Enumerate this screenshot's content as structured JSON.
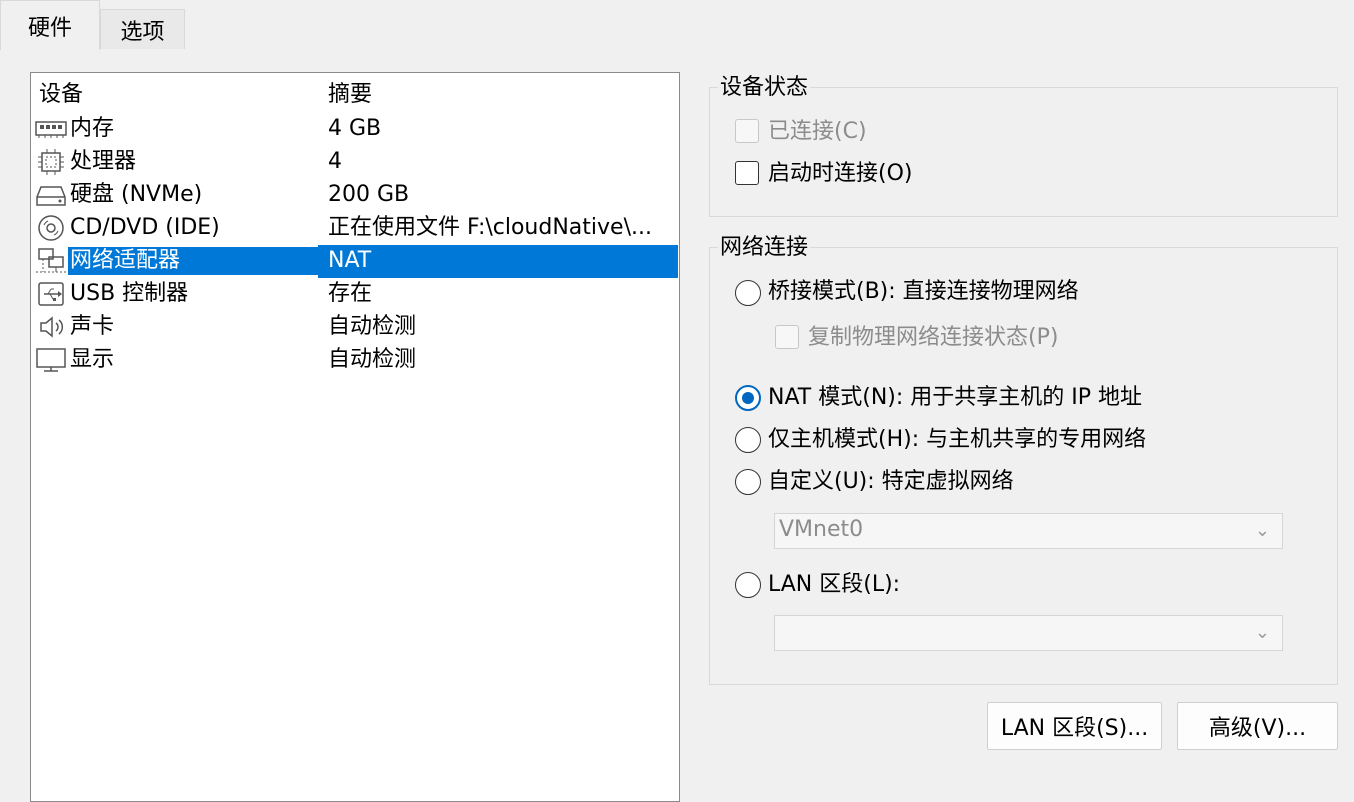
{
  "tabs": {
    "hardware": "硬件",
    "options": "选项"
  },
  "device_list": {
    "header_device": "设备",
    "header_summary": "摘要",
    "rows": [
      {
        "name": "内存",
        "summary": "4 GB",
        "icon": "memory-icon"
      },
      {
        "name": "处理器",
        "summary": "4",
        "icon": "processor-icon"
      },
      {
        "name": "硬盘 (NVMe)",
        "summary": "200 GB",
        "icon": "harddisk-icon"
      },
      {
        "name": "CD/DVD (IDE)",
        "summary": "正在使用文件 F:\\cloudNative\\...",
        "icon": "cd-dvd-icon"
      },
      {
        "name": "网络适配器",
        "summary": "NAT",
        "icon": "network-adapter-icon",
        "selected": true
      },
      {
        "name": "USB 控制器",
        "summary": "存在",
        "icon": "usb-icon"
      },
      {
        "name": "声卡",
        "summary": "自动检测",
        "icon": "speaker-icon"
      },
      {
        "name": "显示",
        "summary": "自动检测",
        "icon": "monitor-icon"
      }
    ]
  },
  "device_status": {
    "title": "设备状态",
    "connected_label": "已连接(C)",
    "connected_checked": false,
    "connected_enabled": false,
    "connect_at_power_on_label": "启动时连接(O)",
    "connect_at_power_on_checked": false
  },
  "network_connection": {
    "title": "网络连接",
    "bridged_label": "桥接模式(B): 直接连接物理网络",
    "replicate_label": "复制物理网络连接状态(P)",
    "nat_label": "NAT 模式(N): 用于共享主机的 IP 地址",
    "host_only_label": "仅主机模式(H): 与主机共享的专用网络",
    "custom_label": "自定义(U): 特定虚拟网络",
    "custom_select_value": "VMnet0",
    "lan_segment_label": "LAN 区段(L):",
    "lan_segment_select_value": "",
    "selected": "nat"
  },
  "buttons": {
    "lan_segments": "LAN 区段(S)...",
    "advanced": "高级(V)..."
  },
  "colors": {
    "selection": "#0078d7",
    "radio_accent": "#0067c0"
  }
}
